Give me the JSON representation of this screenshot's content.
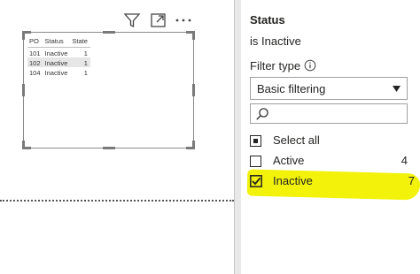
{
  "visual_header": {
    "icons": [
      "filter-icon",
      "focus-mode-icon",
      "more-options-icon"
    ]
  },
  "table": {
    "columns": [
      "PO",
      "Status",
      "State"
    ],
    "rows": [
      [
        "101",
        "Inactive",
        "1"
      ],
      [
        "102",
        "Inactive",
        "1"
      ],
      [
        "104",
        "Inactive",
        "1"
      ]
    ]
  },
  "filter_pane": {
    "field_name": "Status",
    "condition": "is Inactive",
    "filter_type_label": "Filter type",
    "filter_type_value": "Basic filtering",
    "search_placeholder": "",
    "items": [
      {
        "label": "Select all",
        "count": "",
        "state": "partial"
      },
      {
        "label": "Active",
        "count": "4",
        "state": "unchecked"
      },
      {
        "label": "Inactive",
        "count": "7",
        "state": "checked"
      }
    ]
  },
  "colors": {
    "highlight": "#f2f20a",
    "pane_background": "#ffffff",
    "pane_border": "#e8e8e8"
  }
}
